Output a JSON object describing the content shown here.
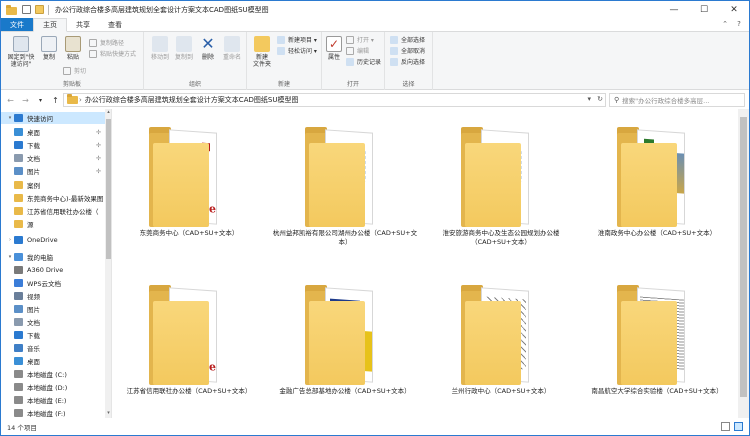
{
  "window": {
    "title": "办公行政综合楼多高层建筑规划全套设计方案文本CAD图纸SU模型图",
    "controls": [
      "—",
      "☐",
      "✕"
    ]
  },
  "ribbon_tabs": [
    {
      "label": "文件"
    },
    {
      "label": "主页"
    },
    {
      "label": "共享"
    },
    {
      "label": "查看"
    }
  ],
  "ribbon": {
    "clipboard": {
      "label": "剪贴板",
      "pin": "固定到\"快速访问\"",
      "copy": "复制",
      "paste": "粘贴",
      "cut": "剪切",
      "copy_path": "复制路径",
      "paste_shortcut": "粘贴快捷方式"
    },
    "organize": {
      "label": "组织",
      "move_to": "移动到",
      "copy_to": "复制到",
      "delete": "删除",
      "rename": "重命名"
    },
    "new": {
      "label": "新建",
      "new_folder": "新建\n文件夹",
      "new_item": "新建项目 ▾",
      "easy_access": "轻松访问 ▾"
    },
    "open": {
      "label": "打开",
      "properties": "属性",
      "open": "打开 ▾",
      "edit": "编辑",
      "history": "历史记录"
    },
    "select": {
      "label": "选择",
      "select_all": "全部选择",
      "select_none": "全部取消",
      "invert": "反向选择"
    }
  },
  "address": {
    "path": "办公行政综合楼多高层建筑规划全套设计方案文本CAD图纸SU模型图",
    "search_placeholder": "搜索\"办公行政综合楼多高层...",
    "icons": [
      "back-arrow-icon",
      "forward-arrow-icon",
      "recent-dropdown-icon",
      "up-arrow-icon",
      "refresh-icon",
      "search-icon"
    ]
  },
  "navpane": {
    "items": [
      {
        "label": "快速访问",
        "icon": "star-icon",
        "selected": true,
        "expander": "▾"
      },
      {
        "label": "桌面",
        "icon": "desktop-icon",
        "pinned": true
      },
      {
        "label": "下载",
        "icon": "download-icon",
        "pinned": true
      },
      {
        "label": "文档",
        "icon": "documents-icon",
        "pinned": true
      },
      {
        "label": "图片",
        "icon": "pictures-icon",
        "pinned": true
      },
      {
        "label": "案例",
        "icon": "folder-icon"
      },
      {
        "label": "东莞商务中心)-最新效果图",
        "icon": "folder-icon"
      },
      {
        "label": "江苏省信用联社办公楼（",
        "icon": "folder-icon"
      },
      {
        "label": "源",
        "icon": "folder-icon"
      },
      {
        "label": "OneDrive",
        "icon": "cloud-icon",
        "expander": "›"
      },
      {
        "label": "我的电脑",
        "icon": "computer-icon",
        "expander": "▾"
      },
      {
        "label": "A360 Drive",
        "icon": "cloud-drive-icon"
      },
      {
        "label": "WPS云文档",
        "icon": "wps-cloud-icon"
      },
      {
        "label": "视频",
        "icon": "videos-icon"
      },
      {
        "label": "图片",
        "icon": "pictures-icon"
      },
      {
        "label": "文档",
        "icon": "documents-icon"
      },
      {
        "label": "下载",
        "icon": "download-icon"
      },
      {
        "label": "音乐",
        "icon": "music-icon"
      },
      {
        "label": "桌面",
        "icon": "desktop-icon"
      },
      {
        "label": "本地磁盘 (C:)",
        "icon": "drive-icon"
      },
      {
        "label": "本地磁盘 (D:)",
        "icon": "drive-icon"
      },
      {
        "label": "本地磁盘 (E:)",
        "icon": "drive-icon"
      },
      {
        "label": "本地磁盘 (F:)",
        "icon": "drive-icon"
      }
    ]
  },
  "folders": [
    {
      "name": "东莞商务中心（CAD+SU+文本）"
    },
    {
      "name": "杭州益邦凯裕有限公司湖州办公楼（CAD+SU+文本）"
    },
    {
      "name": "淮安旅游商务中心及生态公园规划办公楼（CAD+SU+文本）"
    },
    {
      "name": "淮南政务中心办公楼（CAD+SU+文本）"
    },
    {
      "name": "江苏省信用联社办公楼（CAD+SU+文本）"
    },
    {
      "name": "金融广告总部基地办公楼（CAD+SU+文本）"
    },
    {
      "name": "兰州行政中心（CAD+SU+文本）"
    },
    {
      "name": "南昌航空大学综合实验楼（CAD+SU+文本）"
    }
  ],
  "status": {
    "item_count": "14 个项目"
  },
  "colors": {
    "accent": "#1979ca",
    "folder": "#f3c95e",
    "selection": "#cce8ff"
  }
}
